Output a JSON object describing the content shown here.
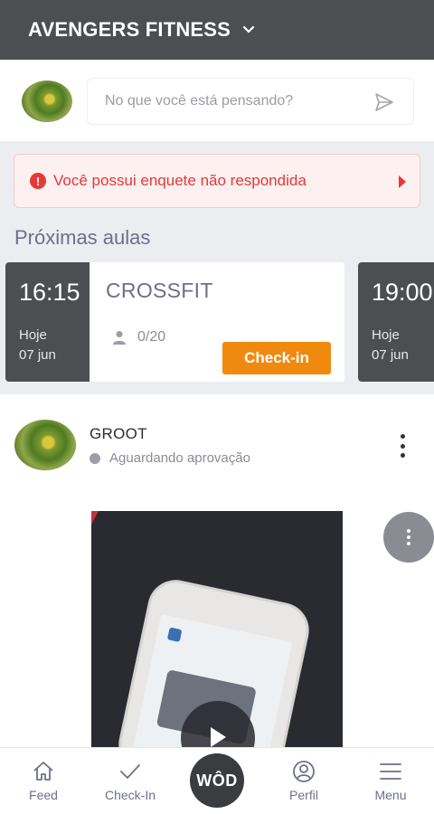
{
  "header": {
    "title": "AVENGERS FITNESS"
  },
  "composer": {
    "placeholder": "No que você está pensando?"
  },
  "alert": {
    "text": "Você possui enquete não respondida"
  },
  "schedule": {
    "title": "Próximas aulas",
    "classes": [
      {
        "time": "16:15",
        "day": "Hoje",
        "date": "07 jun",
        "name": "CROSSFIT",
        "capacity": "0/20",
        "action": "Check-in"
      },
      {
        "time": "19:00",
        "day": "Hoje",
        "date": "07 jun"
      }
    ]
  },
  "post": {
    "author": "GROOT",
    "status": "Aguardando aprovação"
  },
  "nav": {
    "feed": "Feed",
    "checkin": "Check-In",
    "wod": "WÔD",
    "perfil": "Perfil",
    "menu": "Menu"
  },
  "colors": {
    "topbar": "#4d4e52",
    "accent": "#f08a0f",
    "alert": "#e53935",
    "muted": "#6d6f8a"
  }
}
